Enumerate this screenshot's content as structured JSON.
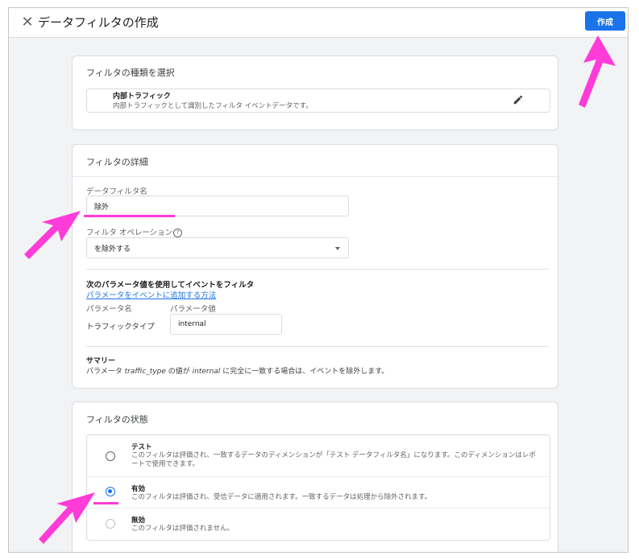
{
  "header": {
    "title": "データフィルタの作成",
    "create_label": "作成"
  },
  "filter_type": {
    "card_title": "フィルタの種類を選択",
    "name": "内部トラフィック",
    "description": "内部トラフィックとして識別したフィルタ イベントデータです。"
  },
  "filter_details": {
    "card_title": "フィルタの詳細",
    "name_label": "データフィルタ名",
    "name_value": "除外",
    "operation_label": "フィルタ オペレーション",
    "operation_value": "を除外する",
    "params_heading": "次のパラメータ値を使用してイベントをフィルタ",
    "params_link": "パラメータをイベントに追加する方法",
    "param_name_header": "パラメータ名",
    "param_value_header": "パラメータ値",
    "param_name": "トラフィックタイプ",
    "param_value": "internal",
    "summary_title": "サマリー",
    "summary_prefix": "パラメータ ",
    "summary_param": "traffic_type",
    "summary_mid": " の値が ",
    "summary_value": "internal",
    "summary_suffix": " に完全に一致する場合は、イベントを除外します。"
  },
  "filter_status": {
    "card_title": "フィルタの状態",
    "options": [
      {
        "title": "テスト",
        "desc": "このフィルタは評価され、一致するデータのディメンションが「テスト データフィルタ名」になります。このディメンションはレポートで使用できます。",
        "selected": false
      },
      {
        "title": "有効",
        "desc": "このフィルタは評価され、受信データに適用されます。一致するデータは処理から除外されます。",
        "selected": true
      },
      {
        "title": "無効",
        "desc": "このフィルタは評価されません。",
        "selected": false
      }
    ]
  },
  "colors": {
    "accent": "#1a73e8",
    "annotation": "#ff3bd8"
  },
  "icons": {
    "close": "close-icon",
    "edit": "pencil-icon",
    "help": "help-icon",
    "dropdown": "chevron-down-icon"
  }
}
